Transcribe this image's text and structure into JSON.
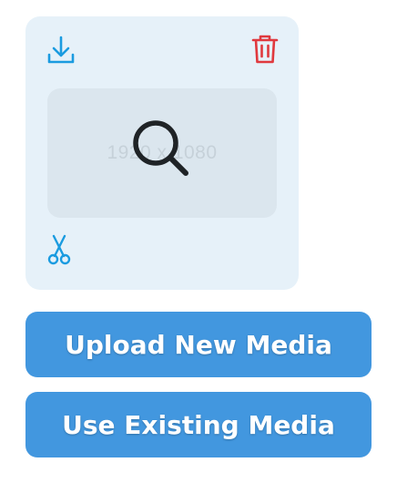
{
  "media_card": {
    "preview_dimensions": "1920 x 1080",
    "icons": {
      "download": "download-icon",
      "delete": "trash-icon",
      "cut": "scissors-icon",
      "zoom": "magnifier-icon"
    }
  },
  "actions": {
    "upload_label": "Upload New Media",
    "existing_label": "Use Existing Media"
  },
  "colors": {
    "accent": "#4297df",
    "icon_blue": "#1a9be0",
    "delete_red": "#e0393e",
    "card_bg": "#e6f1f9",
    "preview_bg": "#dbe6ee"
  }
}
